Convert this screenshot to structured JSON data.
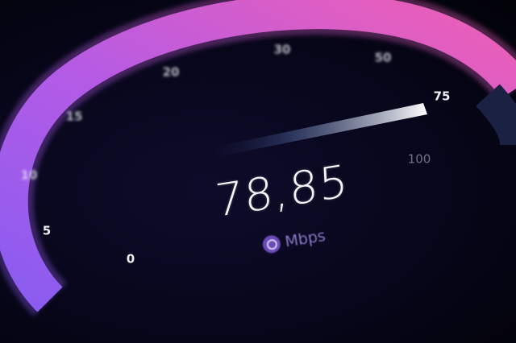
{
  "speedometer": {
    "value": "78,85",
    "unit": "Mbps",
    "unit_icon": "gauge-icon",
    "scale_labels": [
      "0",
      "5",
      "10",
      "15",
      "20",
      "30",
      "50",
      "75",
      "100"
    ],
    "colors": {
      "arc_start": "#8a5cf0",
      "arc_mid": "#b45be6",
      "arc_end": "#f05fb4",
      "needle": "#ffffff",
      "background": "#050414"
    }
  }
}
